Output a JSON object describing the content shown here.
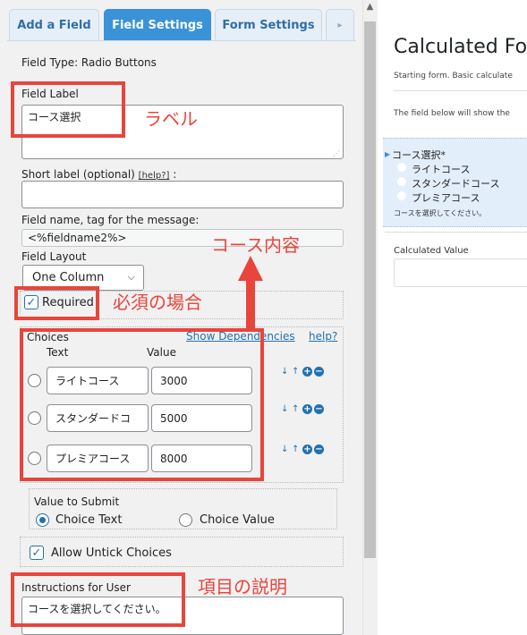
{
  "tabs": [
    {
      "label": "Add a Field",
      "active": false
    },
    {
      "label": "Field Settings",
      "active": true
    },
    {
      "label": "Form Settings",
      "active": false
    }
  ],
  "tab_arrow": "▸",
  "field_type": "Field Type: Radio Buttons",
  "field_label": {
    "label": "Field Label",
    "value": "コース選択"
  },
  "short_label": {
    "label": "Short label (optional) ",
    "help": "[help?]",
    "suffix": " :",
    "value": ""
  },
  "field_name": {
    "label": "Field name, tag for the message:",
    "value": "<%fieldname2%>"
  },
  "field_layout": {
    "label": "Field Layout",
    "value": "One Column"
  },
  "required_label": "Required",
  "choices": {
    "title": "Choices",
    "show_dependencies": "Show Dependencies",
    "help": "help?",
    "col_text": "Text",
    "col_value": "Value",
    "items": [
      {
        "text": "ライトコース",
        "value": "3000"
      },
      {
        "text": "スタンダードコ",
        "value": "5000"
      },
      {
        "text": "プレミアコース",
        "value": "8000"
      }
    ]
  },
  "value_to_submit": {
    "label": "Value to Submit",
    "option_text": "Choice Text",
    "option_value": "Choice Value",
    "selected": "Choice Text"
  },
  "allow_untick": "Allow Untick Choices",
  "instructions": {
    "label": "Instructions for User",
    "value": "コースを選択してください。"
  },
  "annotations": {
    "label": "ラベル",
    "course": "コース内容",
    "required": "必須の場合",
    "description": "項目の説明"
  },
  "preview": {
    "title": "Calculated Fo",
    "subtitle": "Starting form. Basic calculate",
    "note": "The field below will show the",
    "field_label": "コース選択*",
    "options": [
      "ライトコース",
      "スタンダードコース",
      "プレミアコース"
    ],
    "instructions": "コースを選択してください。",
    "calc_label": "Calculated Value"
  },
  "colors": {
    "accent": "#3a93d8",
    "annotation": "#e8453c",
    "link": "#2271b1"
  }
}
